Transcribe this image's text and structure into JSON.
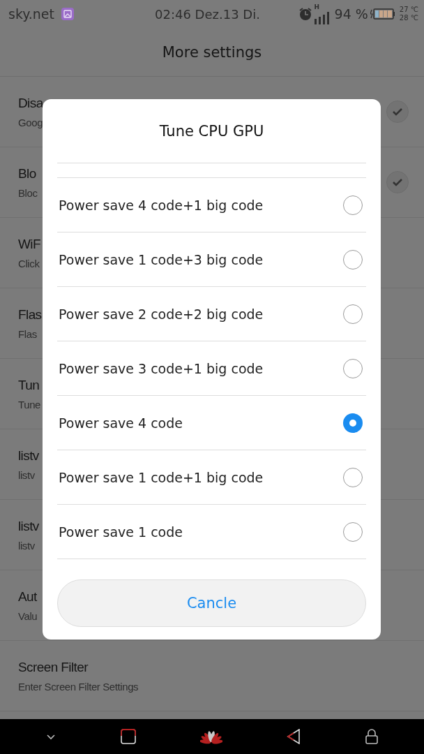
{
  "status_bar": {
    "carrier": "sky.net",
    "clock": "02:46 Dez.13 Di.",
    "network": "H",
    "battery_percent": "94 %",
    "temps": [
      "27 ℃",
      "28 ℃"
    ]
  },
  "header": {
    "title": "More settings"
  },
  "settings": [
    {
      "kind": "checkbox",
      "title": "Disa",
      "subtitle": "Goog",
      "checked": true
    },
    {
      "kind": "checkbox",
      "title": "Blo",
      "subtitle": "Bloc",
      "checked": true
    },
    {
      "kind": "plain",
      "title": "WiF",
      "subtitle": "Click"
    },
    {
      "kind": "plain",
      "title": "Flas",
      "subtitle": "Flas"
    },
    {
      "kind": "plain",
      "title": "Tun",
      "subtitle": "Tune"
    },
    {
      "kind": "plain",
      "title": "listv",
      "subtitle": "listv"
    },
    {
      "kind": "plain",
      "title": "listv",
      "subtitle": "listv"
    },
    {
      "kind": "plain",
      "title": "Aut",
      "subtitle": "Valu"
    },
    {
      "kind": "plain",
      "title": "Screen Filter",
      "subtitle": "Enter Screen Filter Settings"
    }
  ],
  "dialog": {
    "title": "Tune CPU GPU",
    "options": [
      {
        "label": "Power save 4 code+1 big code",
        "selected": false
      },
      {
        "label": "Power save 1 code+3 big code",
        "selected": false
      },
      {
        "label": "Power save 2 code+2 big code",
        "selected": false
      },
      {
        "label": "Power save 3 code+1 big code",
        "selected": false
      },
      {
        "label": "Power save 4 code",
        "selected": true
      },
      {
        "label": "Power save 1 code+1 big code",
        "selected": false
      },
      {
        "label": "Power save 1 code",
        "selected": false
      }
    ],
    "cancel": "Cancle"
  }
}
